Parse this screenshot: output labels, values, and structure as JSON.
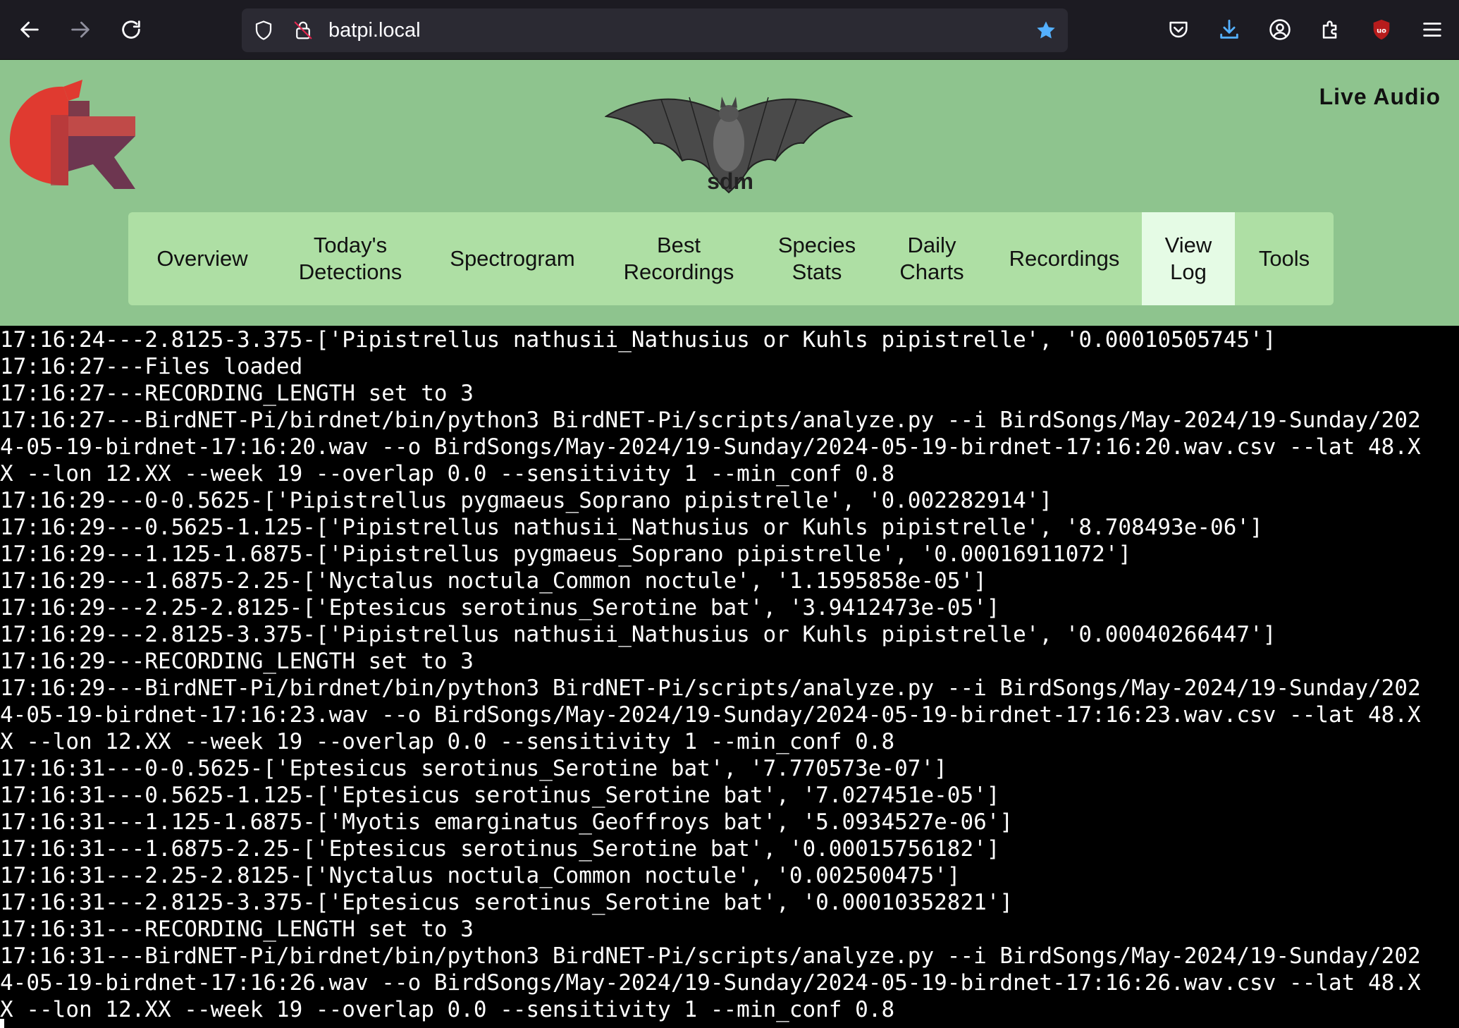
{
  "browser": {
    "url": "batpi.local",
    "colors": {
      "toolbar": "#1c1b22",
      "urlbar": "#2b2a33",
      "bookmark_star": "#54b0ff",
      "download": "#54b0ff",
      "ublock": "#b71c1c"
    }
  },
  "site": {
    "title": "sdm",
    "live_audio_label": "Live Audio",
    "header_color": "#8ec48e",
    "nav_color": "#aedfa4",
    "nav_active_color": "#e5fbe5",
    "nav": [
      {
        "line1": "Overview",
        "line2": ""
      },
      {
        "line1": "Today's",
        "line2": "Detections"
      },
      {
        "line1": "Spectrogram",
        "line2": ""
      },
      {
        "line1": "Best",
        "line2": "Recordings"
      },
      {
        "line1": "Species",
        "line2": "Stats"
      },
      {
        "line1": "Daily",
        "line2": "Charts"
      },
      {
        "line1": "Recordings",
        "line2": ""
      },
      {
        "line1": "View",
        "line2": "Log",
        "active": true
      },
      {
        "line1": "Tools",
        "line2": ""
      }
    ]
  },
  "log": {
    "lines": [
      "17:16:24---2.8125-3.375-['Pipistrellus nathusii_Nathusius or Kuhls pipistrelle', '0.00010505745']",
      "17:16:27---Files loaded",
      "17:16:27---RECORDING_LENGTH set to 3",
      "17:16:27---BirdNET-Pi/birdnet/bin/python3 BirdNET-Pi/scripts/analyze.py --i BirdSongs/May-2024/19-Sunday/202",
      "4-05-19-birdnet-17:16:20.wav --o BirdSongs/May-2024/19-Sunday/2024-05-19-birdnet-17:16:20.wav.csv --lat 48.X",
      "X --lon 12.XX --week 19 --overlap 0.0 --sensitivity 1 --min_conf 0.8",
      "17:16:29---0-0.5625-['Pipistrellus pygmaeus_Soprano pipistrelle', '0.002282914']",
      "17:16:29---0.5625-1.125-['Pipistrellus nathusii_Nathusius or Kuhls pipistrelle', '8.708493e-06']",
      "17:16:29---1.125-1.6875-['Pipistrellus pygmaeus_Soprano pipistrelle', '0.00016911072']",
      "17:16:29---1.6875-2.25-['Nyctalus noctula_Common noctule', '1.1595858e-05']",
      "17:16:29---2.25-2.8125-['Eptesicus serotinus_Serotine bat', '3.9412473e-05']",
      "17:16:29---2.8125-3.375-['Pipistrellus nathusii_Nathusius or Kuhls pipistrelle', '0.00040266447']",
      "17:16:29---RECORDING_LENGTH set to 3",
      "17:16:29---BirdNET-Pi/birdnet/bin/python3 BirdNET-Pi/scripts/analyze.py --i BirdSongs/May-2024/19-Sunday/202",
      "4-05-19-birdnet-17:16:23.wav --o BirdSongs/May-2024/19-Sunday/2024-05-19-birdnet-17:16:23.wav.csv --lat 48.X",
      "X --lon 12.XX --week 19 --overlap 0.0 --sensitivity 1 --min_conf 0.8",
      "17:16:31---0-0.5625-['Eptesicus serotinus_Serotine bat', '7.770573e-07']",
      "17:16:31---0.5625-1.125-['Eptesicus serotinus_Serotine bat', '7.027451e-05']",
      "17:16:31---1.125-1.6875-['Myotis emarginatus_Geoffroys bat', '5.0934527e-06']",
      "17:16:31---1.6875-2.25-['Eptesicus serotinus_Serotine bat', '0.00015756182']",
      "17:16:31---2.25-2.8125-['Nyctalus noctula_Common noctule', '0.002500475']",
      "17:16:31---2.8125-3.375-['Eptesicus serotinus_Serotine bat', '0.00010352821']",
      "17:16:31---RECORDING_LENGTH set to 3",
      "17:16:31---BirdNET-Pi/birdnet/bin/python3 BirdNET-Pi/scripts/analyze.py --i BirdSongs/May-2024/19-Sunday/202",
      "4-05-19-birdnet-17:16:26.wav --o BirdSongs/May-2024/19-Sunday/2024-05-19-birdnet-17:16:26.wav.csv --lat 48.X",
      "X --lon 12.XX --week 19 --overlap 0.0 --sensitivity 1 --min_conf 0.8"
    ]
  }
}
